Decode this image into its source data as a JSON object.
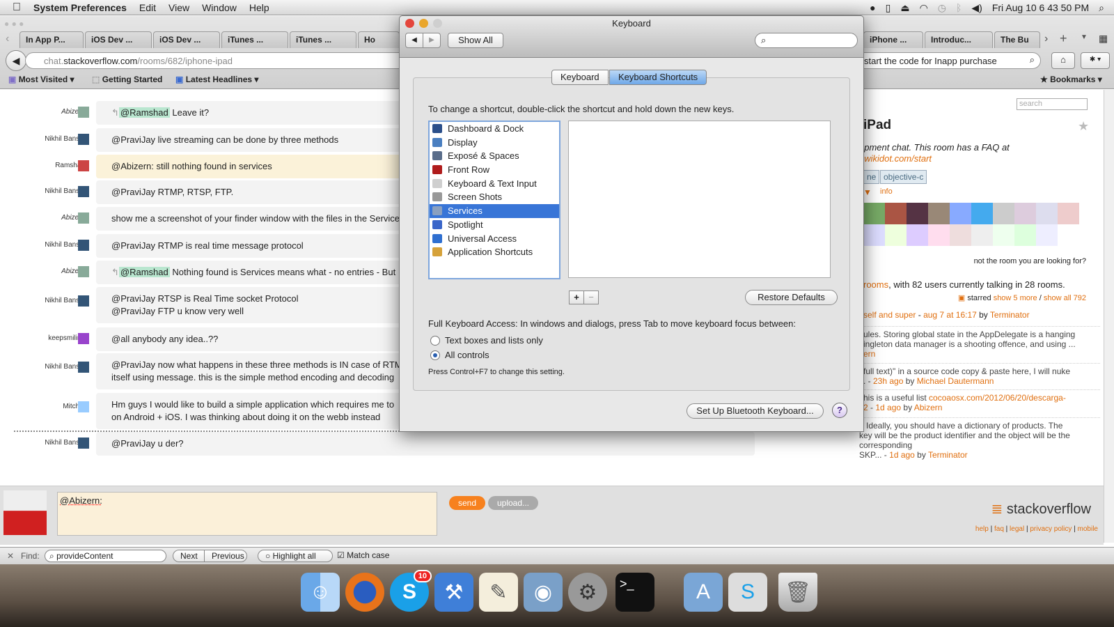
{
  "menubar": {
    "app": "System Preferences",
    "items": [
      "Edit",
      "View",
      "Window",
      "Help"
    ],
    "clock": "Fri Aug 10  6 43 50 PM"
  },
  "browser": {
    "tabs": [
      "In App P...",
      "iOS Dev ...",
      "iOS Dev ...",
      "iTunes ...",
      "iTunes ...",
      "Ho",
      "iPhone ...",
      "Introduc...",
      "The Bu"
    ],
    "url_host_prefix": "chat.",
    "url_host": "stackoverflow.com",
    "url_path": "/rooms/682/iphone-ipad",
    "search_value": "start the code for Inapp purchase",
    "bookmarks": [
      "Most Visited ▾",
      "Getting Started",
      "Latest Headlines ▾"
    ],
    "bookmarks_menu": "Bookmarks ▾"
  },
  "chat": {
    "messages": [
      {
        "user": "Abizern",
        "italic": true,
        "ping": "@Ramshad",
        "text": " Leave it?",
        "reply": true
      },
      {
        "user": "Nikhil Bansal",
        "text": "@PraviJay live streaming can be done by three methods"
      },
      {
        "user": "Ramshad",
        "text": "@Abizern: still nothing found in services",
        "hl": true
      },
      {
        "user": "Nikhil Bansal",
        "text": "@PraviJay RTMP, RTSP, FTP."
      },
      {
        "user": "Abizern",
        "italic": true,
        "text": "show me a screenshot of your finder window with the files in the Services folder"
      },
      {
        "user": "Nikhil Bansal",
        "text": "@PraviJay RTMP is real time message protocol"
      },
      {
        "user": "Abizern",
        "italic": true,
        "ping": "@Ramshad",
        "text": " Nothing found is Services means what - no entries - But",
        "reply": true
      },
      {
        "user": "Nikhil Bansal",
        "text": "@PraviJay RTSP is Real Time socket Protocol",
        "text2": "@PraviJay FTP u know very well"
      },
      {
        "user": "keepsmiling",
        "text": "@all anybody any idea..??"
      },
      {
        "user": "Nikhil Bansal",
        "text": "@PraviJay now what happens in these three methods is IN case of RTMP",
        "text2": "itself using message. this is the simple method encoding and decoding"
      },
      {
        "user": "Mitchel",
        "text": "Hm guys I would like to build a simple application which requires me to",
        "text2": "on Android + iOS. I was thinking about doing it on the webb instead"
      },
      {
        "user": "Nikhil Bansal",
        "text": "@PraviJay u der?"
      }
    ],
    "input_value": "@Abizern:",
    "send": "send",
    "upload": "upload..."
  },
  "sidebar": {
    "search_placeholder": "search",
    "title": "iPad",
    "desc": "opment chat. This room has a FAQ at",
    "faq_link": "t.wikidot.com/start",
    "tags": [
      "ne",
      "objective-c"
    ],
    "info": "info",
    "not_room": "not the room you are looking for?",
    "rooms_link": "rooms",
    "rooms_text": ", with 82 users currently talking in 28 rooms.",
    "starred": "starred",
    "show_more": "show 5 more",
    "show_all": "show all 792",
    "starred_items": [
      {
        "a": "self and super",
        "b": " - ",
        "c": "aug 7 at 16:17",
        "d": " by ",
        "e": "Terminator"
      },
      {
        "t1": "ules. Storing global state in the AppDelegate is a hanging",
        "t2": "ingleton data manager is a shooting offence, and using ...",
        "e": "ern"
      },
      {
        "t1": "full text)\" in a source code copy & paste here, I will nuke",
        "c": "23h ago",
        "e": "Michael Dautermann"
      },
      {
        "t1": "his is a useful list ",
        "l": "cocoaosx.com/2012/06/20/descarga-",
        "l2": "2",
        "c": "1d ago",
        "e": "Abizern"
      },
      {
        "t1": "Ideally, you should have a dictionary of products. The",
        "t2": "key will be the product identifier and the object will be the corresponding",
        "t3": "SKP...",
        "c": "1d ago",
        "e": "Terminator"
      }
    ],
    "logo": "stackoverflow",
    "footer": [
      "help",
      "faq",
      "legal",
      "privacy policy",
      "mobile"
    ]
  },
  "findbar": {
    "label": "Find:",
    "value": "provideContent",
    "next": "Next",
    "previous": "Previous",
    "highlight": "Highlight all",
    "match": "Match case"
  },
  "dock": {
    "badge": "10"
  },
  "dialog": {
    "title": "Keyboard",
    "show_all": "Show All",
    "tabs": [
      "Keyboard",
      "Keyboard Shortcuts"
    ],
    "selected_tab": 1,
    "instruction": "To change a shortcut, double-click the shortcut and hold down the new keys.",
    "categories": [
      {
        "label": "Dashboard & Dock",
        "color": "#2b4f8a"
      },
      {
        "label": "Display",
        "color": "#4a7fc0"
      },
      {
        "label": "Exposé & Spaces",
        "color": "#5a6d8a"
      },
      {
        "label": "Front Row",
        "color": "#b01c1c"
      },
      {
        "label": "Keyboard & Text Input",
        "color": "#cfcfcf"
      },
      {
        "label": "Screen Shots",
        "color": "#999999"
      },
      {
        "label": "Services",
        "color": "#8aa0c0"
      },
      {
        "label": "Spotlight",
        "color": "#3a66c9"
      },
      {
        "label": "Universal Access",
        "color": "#2f6fd0"
      },
      {
        "label": "Application Shortcuts",
        "color": "#d6a23a"
      }
    ],
    "selected": 6,
    "plus": "+",
    "minus": "−",
    "restore": "Restore Defaults",
    "fka": "Full Keyboard Access: In windows and dialogs, press Tab to move keyboard focus between:",
    "radios": [
      "Text boxes and lists only",
      "All controls"
    ],
    "radio_selected": 1,
    "hint": "Press Control+F7 to change this setting.",
    "bluetooth": "Set Up Bluetooth Keyboard...",
    "help": "?"
  }
}
